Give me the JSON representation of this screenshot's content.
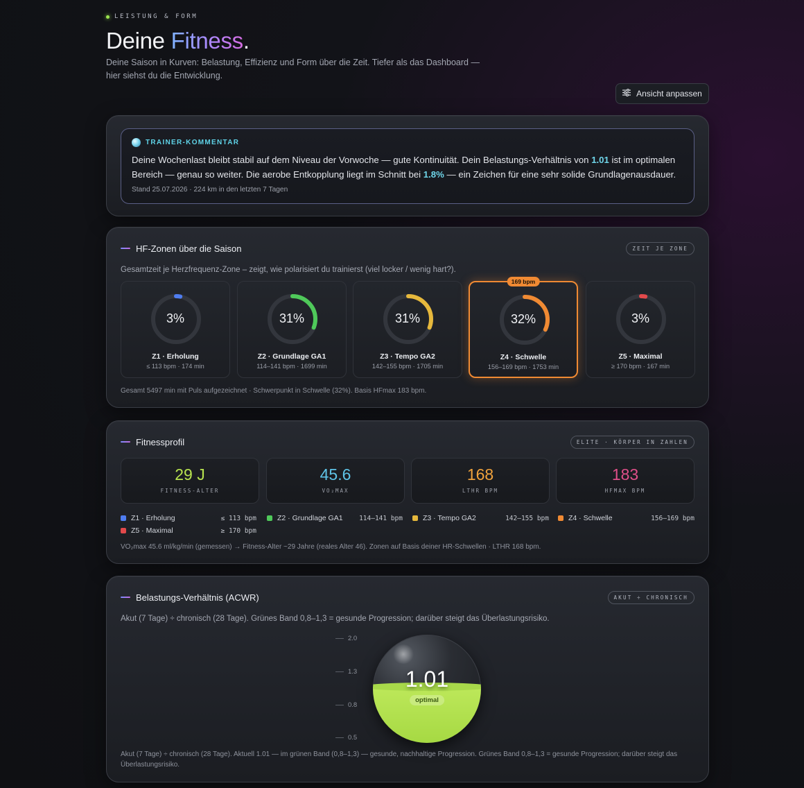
{
  "header": {
    "eyebrow": "LEISTUNG & FORM",
    "title_main": "Deine ",
    "title_accent": "Fitness",
    "title_dot": ".",
    "subtitle": "Deine Saison in Kurven: Belastung, Effizienz und Form über die Zeit. Tiefer als das Dashboard — hier siehst du die Entwicklung.",
    "adjust_button": "Ansicht anpassen"
  },
  "trainer": {
    "label": "TRAINER-KOMMENTAR",
    "text_1": "Deine Wochenlast bleibt stabil auf dem Niveau der Vorwoche — gute Kontinuität. Dein Belastungs-Verhältnis von ",
    "hl_1": "1.01",
    "text_2": " ist im optimalen Bereich — genau so weiter. Die aerobe Entkopplung liegt im Schnitt bei ",
    "hl_2": "1.8%",
    "text_3": " — ein Zeichen für eine sehr solide Grundlagenausdauer.",
    "meta": "Stand 25.07.2026 · 224 km in den letzten 7 Tagen"
  },
  "zones": {
    "title": "HF-Zonen über die Saison",
    "pill": "ZEIT JE ZONE",
    "description": "Gesamtzeit je Herzfrequenz-Zone – zeigt, wie polarisiert du trainierst (viel locker / wenig hart?).",
    "items": [
      {
        "pct_label": "3%",
        "pct": 3,
        "name": "Z1 · Erholung",
        "sub": "≤ 113 bpm · 174 min",
        "color": "#4f7df0"
      },
      {
        "pct_label": "31%",
        "pct": 31,
        "name": "Z2 · Grundlage GA1",
        "sub": "114–141 bpm · 1699 min",
        "color": "#4fc95a"
      },
      {
        "pct_label": "31%",
        "pct": 31,
        "name": "Z3 · Tempo GA2",
        "sub": "142–155 bpm · 1705 min",
        "color": "#e6b83c"
      },
      {
        "pct_label": "32%",
        "pct": 32,
        "name": "Z4 · Schwelle",
        "sub": "156–169 bpm · 1753 min",
        "color": "#f08a33",
        "badge": "169 bpm"
      },
      {
        "pct_label": "3%",
        "pct": 3,
        "name": "Z5 · Maximal",
        "sub": "≥ 170 bpm · 167 min",
        "color": "#e2494b"
      }
    ],
    "footer": "Gesamt 5497 min mit Puls aufgezeichnet · Schwerpunkt in Schwelle (32%). Basis HFmax 183 bpm."
  },
  "profile": {
    "title": "Fitnessprofil",
    "pill": "ELITE · KÖRPER IN ZAHLEN",
    "stats": [
      {
        "value": "29 J",
        "label": "FITNESS-ALTER",
        "color": "#b7e24f"
      },
      {
        "value": "45.6",
        "label": "VO₂MAX",
        "color": "#5fc4e8"
      },
      {
        "value": "168",
        "label": "LTHR BPM",
        "color": "#f0a23c"
      },
      {
        "value": "183",
        "label": "HFMAX BPM",
        "color": "#e04f8a"
      }
    ],
    "legend": [
      {
        "name": "Z1 · Erholung",
        "range": "≤ 113 bpm",
        "color": "#4f7df0"
      },
      {
        "name": "Z2 · Grundlage GA1",
        "range": "114–141 bpm",
        "color": "#4fc95a"
      },
      {
        "name": "Z3 · Tempo GA2",
        "range": "142–155 bpm",
        "color": "#e6b83c"
      },
      {
        "name": "Z4 · Schwelle",
        "range": "156–169 bpm",
        "color": "#f08a33"
      },
      {
        "name": "Z5 · Maximal",
        "range": "≥ 170 bpm",
        "color": "#e2494b"
      }
    ],
    "footer": "VO₂max 45.6 ml/kg/min (gemessen) → Fitness-Alter ~29 Jahre (reales Alter 46). Zonen auf Basis deiner HR-Schwellen · LTHR 168 bpm."
  },
  "acwr": {
    "title": "Belastungs-Verhältnis (ACWR)",
    "pill": "AKUT ÷ CHRONISCH",
    "description": "Akut (7 Tage) ÷ chronisch (28 Tage). Grünes Band 0,8–1,3 = gesunde Progression; darüber steigt das Überlastungsrisiko.",
    "ticks": [
      "2.0",
      "1.3",
      "0.8",
      "0.5"
    ],
    "value": "1.01",
    "status": "optimal",
    "footer": "Akut (7 Tage) ÷ chronisch (28 Tage). Aktuell 1.01 — im grünen Band (0,8–1,3) — gesunde, nachhaltige Progression. Grünes Band 0,8–1,3 = gesunde Progression; darüber steigt das Überlastungsrisiko."
  }
}
